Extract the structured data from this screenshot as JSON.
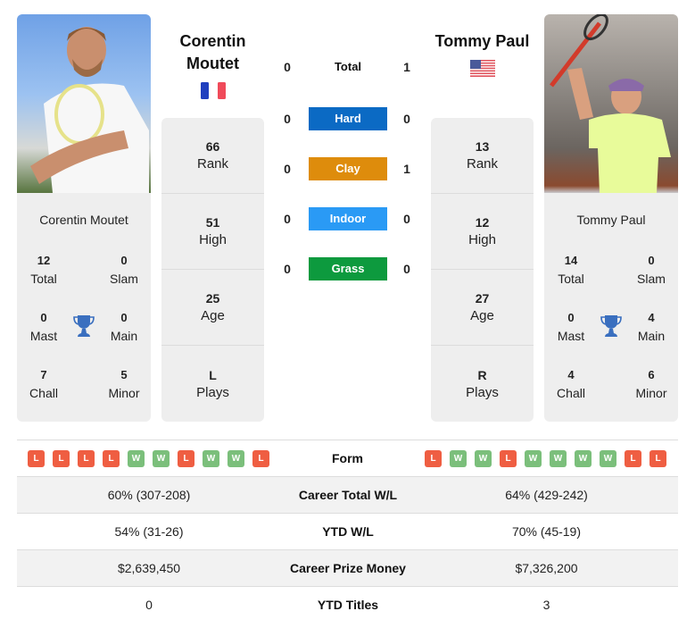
{
  "colors": {
    "hard": "#0b6ac4",
    "clay": "#de8c0c",
    "indoor": "#2a9af5",
    "grass": "#0d9a3e",
    "loss": "#ef5e42",
    "win": "#7bbf7b",
    "trophy": "#3a6fbf"
  },
  "player1": {
    "name": "Corentin Moutet",
    "name_line1": "Corentin",
    "name_line2": "Moutet",
    "flag": "france-flag",
    "photo": "player-photo",
    "titles": {
      "total": {
        "value": "12",
        "label": "Total"
      },
      "slam": {
        "value": "0",
        "label": "Slam"
      },
      "mast": {
        "value": "0",
        "label": "Mast"
      },
      "main": {
        "value": "0",
        "label": "Main"
      },
      "chall": {
        "value": "7",
        "label": "Chall"
      },
      "minor": {
        "value": "5",
        "label": "Minor"
      }
    },
    "stats": [
      {
        "value": "66",
        "label": "Rank"
      },
      {
        "value": "51",
        "label": "High"
      },
      {
        "value": "25",
        "label": "Age"
      },
      {
        "value": "L",
        "label": "Plays"
      }
    ],
    "form": [
      "L",
      "L",
      "L",
      "L",
      "W",
      "W",
      "L",
      "W",
      "W",
      "L"
    ]
  },
  "player2": {
    "name": "Tommy Paul",
    "flag": "usa-flag",
    "photo": "player-photo",
    "titles": {
      "total": {
        "value": "14",
        "label": "Total"
      },
      "slam": {
        "value": "0",
        "label": "Slam"
      },
      "mast": {
        "value": "0",
        "label": "Mast"
      },
      "main": {
        "value": "4",
        "label": "Main"
      },
      "chall": {
        "value": "4",
        "label": "Chall"
      },
      "minor": {
        "value": "6",
        "label": "Minor"
      }
    },
    "stats": [
      {
        "value": "13",
        "label": "Rank"
      },
      {
        "value": "12",
        "label": "High"
      },
      {
        "value": "27",
        "label": "Age"
      },
      {
        "value": "R",
        "label": "Plays"
      }
    ],
    "form": [
      "L",
      "W",
      "W",
      "L",
      "W",
      "W",
      "W",
      "W",
      "L",
      "L"
    ]
  },
  "h2h": [
    {
      "label": "Total",
      "p1": "0",
      "p2": "1"
    },
    {
      "label": "Hard",
      "p1": "0",
      "p2": "0"
    },
    {
      "label": "Clay",
      "p1": "0",
      "p2": "1"
    },
    {
      "label": "Indoor",
      "p1": "0",
      "p2": "0"
    },
    {
      "label": "Grass",
      "p1": "0",
      "p2": "0"
    }
  ],
  "form_label": "Form",
  "comparison": [
    {
      "label": "Career Total W/L",
      "p1": "60% (307-208)",
      "p2": "64% (429-242)"
    },
    {
      "label": "YTD W/L",
      "p1": "54% (31-26)",
      "p2": "70% (45-19)"
    },
    {
      "label": "Career Prize Money",
      "p1": "$2,639,450",
      "p2": "$7,326,200"
    },
    {
      "label": "YTD Titles",
      "p1": "0",
      "p2": "3"
    }
  ]
}
